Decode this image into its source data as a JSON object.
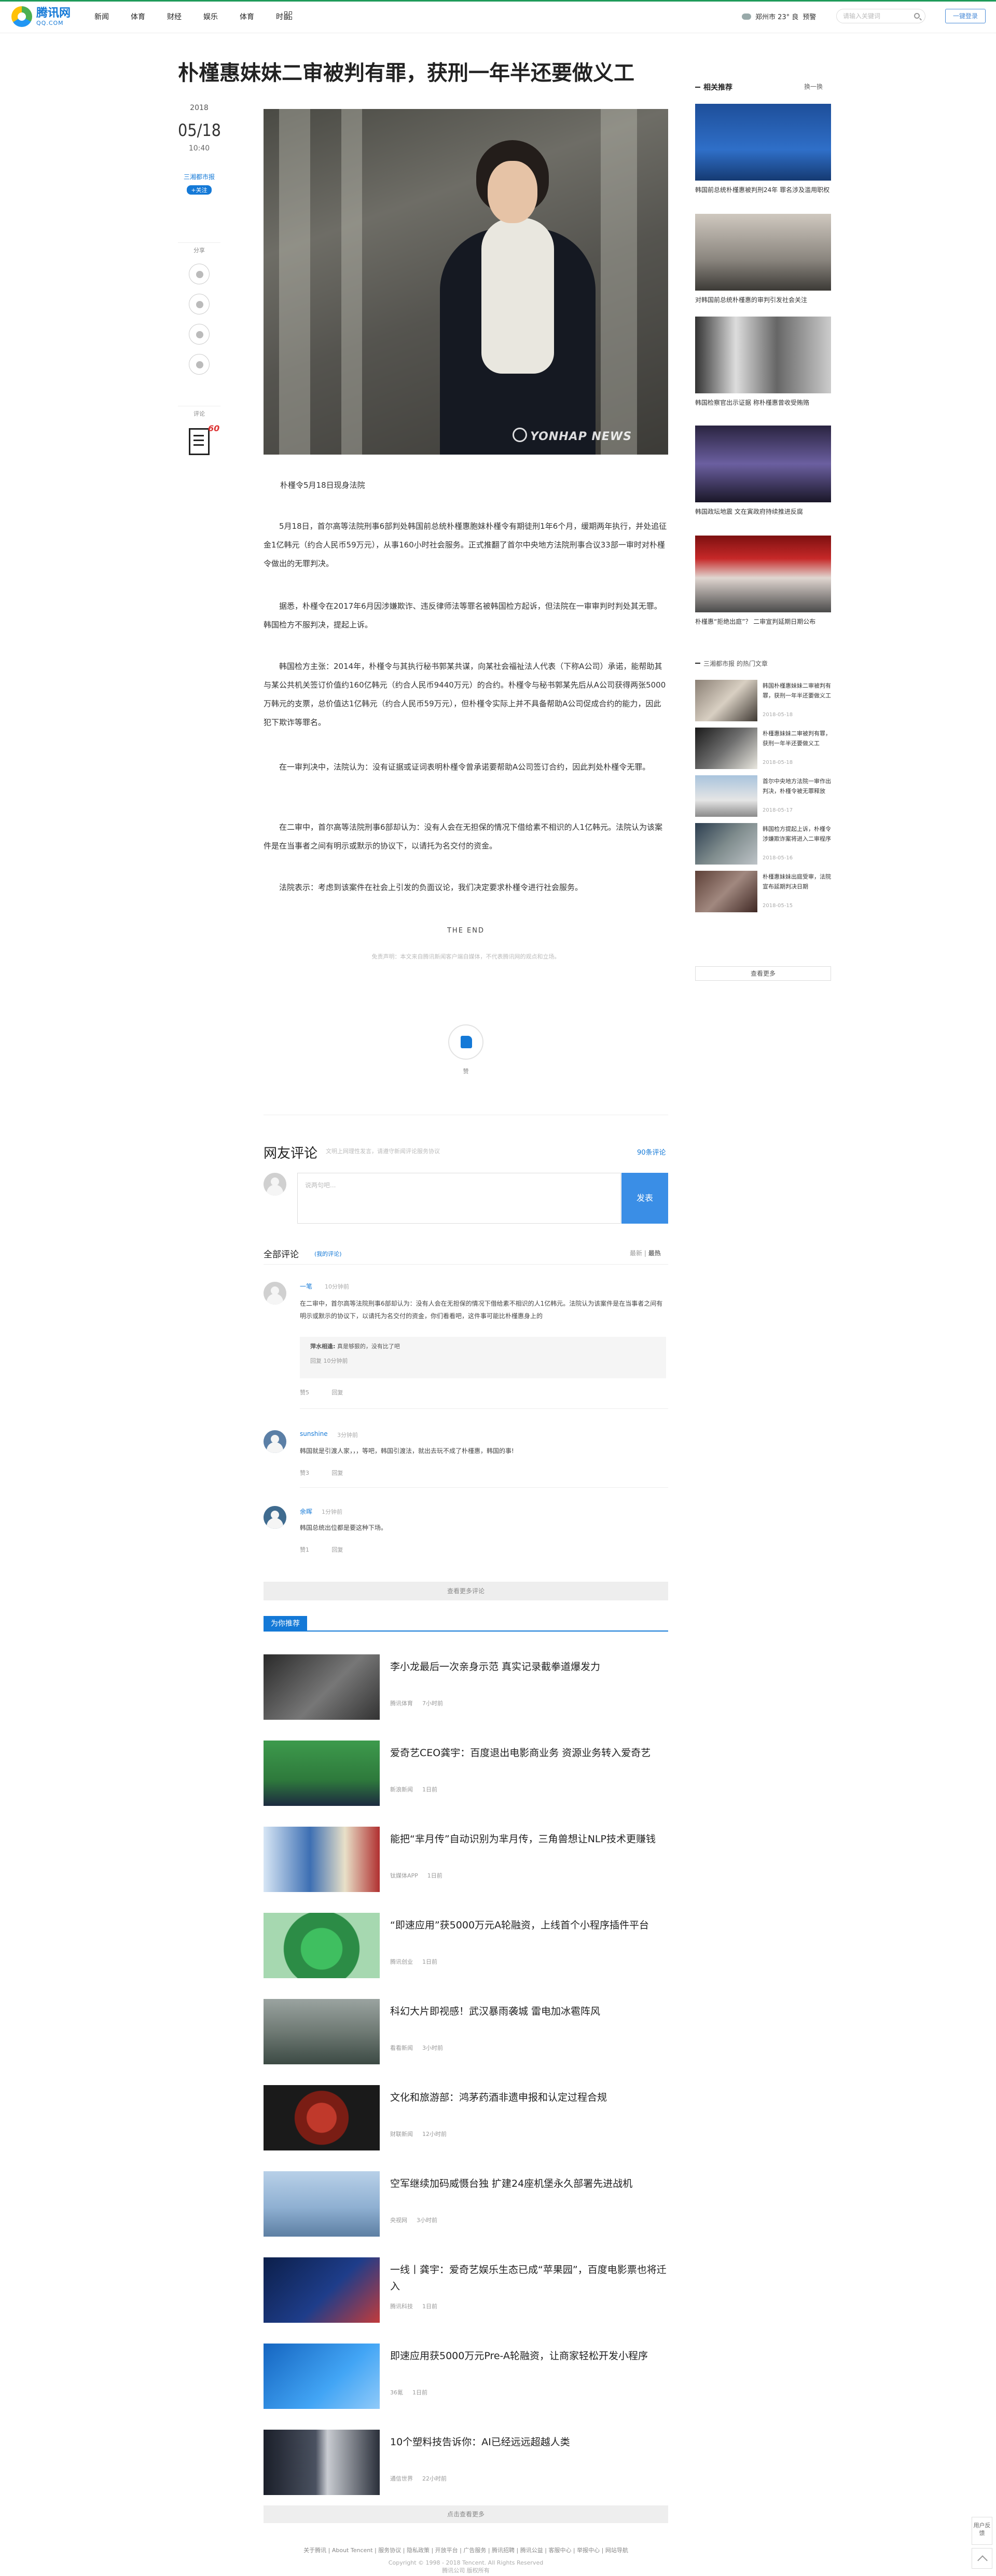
{
  "header": {
    "logo_cn": "腾讯网",
    "logo_en": "QQ.COM",
    "nav": [
      "新闻",
      "体育",
      "财经",
      "娱乐",
      "体育",
      "时尚"
    ],
    "weather": "郑州市 23° 良",
    "weather_link": "预警",
    "search_placeholder": "请输入关键词",
    "login": "一键登录"
  },
  "article": {
    "title": "朴槿惠妹妹二审被判有罪，获刑一年半还要做义工",
    "date_year": "2018",
    "date_md": "05/18",
    "date_time": "10:40",
    "source": "三湘都市报",
    "follow": "+关注",
    "share_label": "分享",
    "comment_label": "评论",
    "comment_count": "60",
    "watermark": "YONHAP NEWS",
    "caption": "朴槿令5月18日现身法院",
    "paragraphs": [
      "5月18日，首尔高等法院刑事6部判处韩国前总统朴槿惠胞妹朴槿令有期徒刑1年6个月，缓期两年执行，并处追征金1亿韩元（约合人民币59万元），从事160小时社会服务。正式推翻了首尔中央地方法院刑事合议33部一审时对朴槿令做出的无罪判决。",
      "据悉，朴槿令在2017年6月因涉嫌欺诈、违反律师法等罪名被韩国检方起诉，但法院在一审审判时判处其无罪。韩国检方不服判决，提起上诉。",
      "韩国检方主张：2014年，朴槿令与其执行秘书郭某共谋，向某社会福祉法人代表（下称A公司）承诺，能帮助其与某公共机关签订价值约160亿韩元（约合人民币9440万元）的合约。朴槿令与秘书郭某先后从A公司获得两张5000万韩元的支票，总价值达1亿韩元（约合人民币59万元），但朴槿令实际上并不具备帮助A公司促成合约的能力，因此犯下欺诈等罪名。",
      "在一审判决中，法院认为：没有证据或证词表明朴槿令曾承诺要帮助A公司签订合约，因此判处朴槿令无罪。",
      "在二审中，首尔高等法院刑事6部却认为：没有人会在无担保的情况下借给素不相识的人1亿韩元。法院认为该案件是在当事者之间有明示或默示的协议下，以请托为名交付的资金。",
      "法院表示：考虑到该案件在社会上引发的负面议论，我们决定要求朴槿令进行社会服务。"
    ],
    "the_end": "THE END",
    "disclaimer": "免责声明：本文来自腾讯新闻客户端自媒体，不代表腾讯网的观点和立场。",
    "like_label": "赞"
  },
  "comments": {
    "title": "网友评论",
    "subtitle": "文明上网理性发言，请遵守新闻评论服务协议",
    "count_link": "90条评论",
    "input_placeholder": "说两句吧...",
    "submit": "发表",
    "all_label": "全部评论",
    "all_sub": "(我的评论)",
    "sort_new": "最新",
    "sort_hot": "最热",
    "items": [
      {
        "name": "一笔",
        "time": "10分钟前",
        "text": "在二审中，首尔高等法院刑事6部却认为：没有人会在无担保的情况下借给素不相识的人1亿韩元。法院认为该案件是在当事者之间有明示或默示的协议下，以请托为名交付的资金，你们看看吧，这件事可能比朴槿惠身上的",
        "reply_name": "萍水相逢:",
        "reply_text": "真是够狠的，没有比了吧",
        "reply_meta": "回复    10分钟前",
        "up": "赞5",
        "reply": "回复"
      },
      {
        "name": "sunshine",
        "time": "3分钟前",
        "text": "韩国就是引渡人家，，，等吧，韩国引渡法，就出去玩不成了朴槿惠，韩国的事!",
        "up": "赞3",
        "reply": "回复"
      },
      {
        "name": "余晖",
        "time": "1分钟前",
        "text": "韩国总统出位都是要这种下场。",
        "up": "赞1",
        "reply": "回复"
      }
    ],
    "load_more": "查看更多评论"
  },
  "recommend": {
    "tag": "为你推荐",
    "items": [
      {
        "title": "李小龙最后一次亲身示范 真实记录截拳道爆发力",
        "source": "腾讯体育",
        "time": "7小时前"
      },
      {
        "title": "爱奇艺CEO龚宇：百度退出电影商业务 资源业务转入爱奇艺",
        "source": "新浪新闻",
        "time": "1日前"
      },
      {
        "title": "能把“芈月传”自动识别为芈月传，三角兽想让NLP技术更赚钱",
        "source": "钛媒体APP",
        "time": "1日前"
      },
      {
        "title": "“即速应用”获5000万元A轮融资，上线首个小程序插件平台",
        "source": "腾讯创业",
        "time": "1日前"
      },
      {
        "title": "科幻大片即视感！武汉暴雨袭城 雷电加冰雹阵风",
        "source": "看看新闻",
        "time": "3小时前"
      },
      {
        "title": "文化和旅游部：鸿茅药酒非遗申报和认定过程合规",
        "source": "财联新闻",
        "time": "12小时前"
      },
      {
        "title": "空军继续加码威慑台独 扩建24座机堡永久部署先进战机",
        "source": "央视网",
        "time": "3小时前"
      },
      {
        "title": "一线丨龚宇：爱奇艺娱乐生态已成“苹果园”，百度电影票也将迁入",
        "source": "腾讯科技",
        "time": "1日前"
      },
      {
        "title": "即速应用获5000万元Pre-A轮融资，让商家轻松开发小程序",
        "source": "36氪",
        "time": "1日前"
      },
      {
        "title": "10个塑料技告诉你：AI已经远远超越人类",
        "source": "通信世界",
        "time": "22小时前"
      }
    ],
    "more": "点击查看更多"
  },
  "sidebar": {
    "related_title": "相关推荐",
    "refresh": "换一换",
    "related": [
      "韩国前总统朴槿惠被判刑24年 罪名涉及滥用职权",
      "对韩国前总统朴槿惠的审判引发社会关注",
      "韩国检察官出示证据 称朴槿惠曾收受贿赂",
      "韩国政坛地震 文在寅政府持续推进反腐",
      "朴槿惠“拒绝出庭”？ 二审宣判延期日期公布"
    ],
    "news_title": "三湘都市报 的热门文章",
    "news": [
      {
        "title": "韩国朴槿惠妹妹二审被判有罪，获刑一年半还要做义工",
        "date": "2018-05-18"
      },
      {
        "title": "朴槿惠妹妹二审被判有罪，获刑一年半还要做义工",
        "date": "2018-05-18"
      },
      {
        "title": "首尔中央地方法院一审作出判决，朴槿令被无罪释放",
        "date": "2018-05-17"
      },
      {
        "title": "韩国检方提起上诉，朴槿令涉嫌欺诈案将进入二审程序",
        "date": "2018-05-16"
      },
      {
        "title": "朴槿惠妹妹出庭受审，法院宣布延期判决日期",
        "date": "2018-05-15"
      }
    ],
    "more": "查看更多"
  },
  "footer": {
    "links": "关于腾讯 | About Tencent | 服务协议 | 隐私政策 | 开放平台 | 广告服务 | 腾讯招聘 | 腾讯公益 | 客服中心 | 举报中心 | 网站导航",
    "copyright": "Copyright © 1998 - 2018 Tencent. All Rights Reserved",
    "company": "腾讯公司 版权所有",
    "feedback": "用户反馈"
  }
}
